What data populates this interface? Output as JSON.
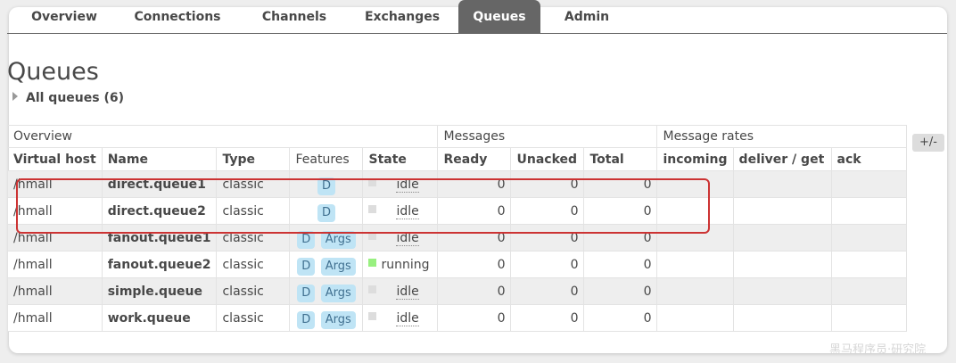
{
  "tabs": [
    "Overview",
    "Connections",
    "Channels",
    "Exchanges",
    "Queues",
    "Admin"
  ],
  "active_tab": "Queues",
  "page_title": "Queues",
  "section": "All queues (6)",
  "toggle_columns_label": "+/-",
  "table": {
    "groups": [
      "Overview",
      "Messages",
      "Message rates"
    ],
    "columns": [
      "Virtual host",
      "Name",
      "Type",
      "Features",
      "State",
      "Ready",
      "Unacked",
      "Total",
      "incoming",
      "deliver / get",
      "ack"
    ],
    "rows": [
      {
        "vhost": "/hmall",
        "name": "direct.queue1",
        "type": "classic",
        "features": [
          "D"
        ],
        "state": "idle",
        "ready": "0",
        "unacked": "0",
        "total": "0"
      },
      {
        "vhost": "/hmall",
        "name": "direct.queue2",
        "type": "classic",
        "features": [
          "D"
        ],
        "state": "idle",
        "ready": "0",
        "unacked": "0",
        "total": "0"
      },
      {
        "vhost": "/hmall",
        "name": "fanout.queue1",
        "type": "classic",
        "features": [
          "D",
          "Args"
        ],
        "state": "idle",
        "ready": "0",
        "unacked": "0",
        "total": "0"
      },
      {
        "vhost": "/hmall",
        "name": "fanout.queue2",
        "type": "classic",
        "features": [
          "D",
          "Args"
        ],
        "state": "running",
        "ready": "0",
        "unacked": "0",
        "total": "0"
      },
      {
        "vhost": "/hmall",
        "name": "simple.queue",
        "type": "classic",
        "features": [
          "D",
          "Args"
        ],
        "state": "idle",
        "ready": "0",
        "unacked": "0",
        "total": "0"
      },
      {
        "vhost": "/hmall",
        "name": "work.queue",
        "type": "classic",
        "features": [
          "D",
          "Args"
        ],
        "state": "idle",
        "ready": "0",
        "unacked": "0",
        "total": "0"
      }
    ]
  },
  "watermark": "黑马程序员·研究院",
  "colors": {
    "active_tab_bg": "#666666",
    "badge_bg": "#bfe4f5",
    "running": "#98f080",
    "highlight": "#cc3333"
  }
}
